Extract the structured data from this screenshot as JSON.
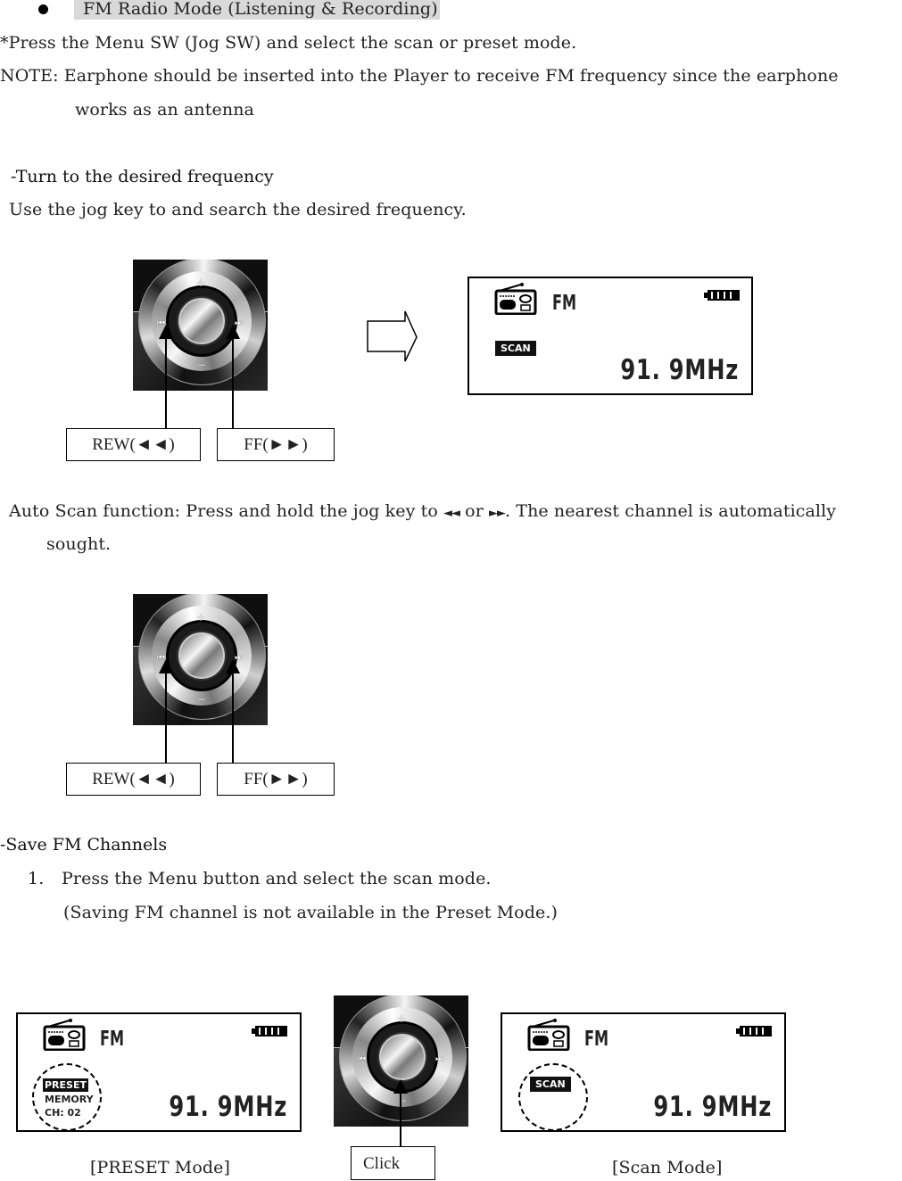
{
  "section": {
    "title": "FM Radio Mode (Listening & Recording)",
    "intro": "*Press the Menu SW (Jog SW) and select the scan or preset mode.",
    "note_line1": "NOTE: Earphone should be inserted into the Player to receive FM frequency since the earphone",
    "note_line2": "works as an antenna"
  },
  "turn": {
    "heading": "-Turn to the desired frequency",
    "body": "Use the jog key to and search the desired frequency."
  },
  "jog_labels": {
    "rew": "REW(◄◄)",
    "ff": "FF(►►)",
    "click": "Click"
  },
  "jog_symbols": {
    "plus": "+",
    "minus": "−",
    "prev": "⏮",
    "next": "⏭"
  },
  "lcd": {
    "band": "FM",
    "frequency": "91. 9MHz",
    "scan_badge": "SCAN",
    "preset_badge": "PRESET",
    "memory_label": "MEMORY",
    "channel_label": "CH: 02",
    "battery_bars": 4
  },
  "auto_scan": {
    "line1_a": "Auto Scan function: Press and hold the jog key to",
    "rew_glyph": "◄◄",
    "or": "or",
    "ff_glyph": "►►",
    "line1_b": ". The nearest channel is automatically",
    "line2": "sought."
  },
  "save": {
    "heading": "-Save FM Channels",
    "step_number": "1.",
    "step_text": "Press the Menu button and select the scan mode.",
    "step_note": "(Saving FM channel is not available in the Preset Mode.)"
  },
  "captions": {
    "preset_mode": "[PRESET Mode]",
    "scan_mode": "[Scan Mode]"
  }
}
